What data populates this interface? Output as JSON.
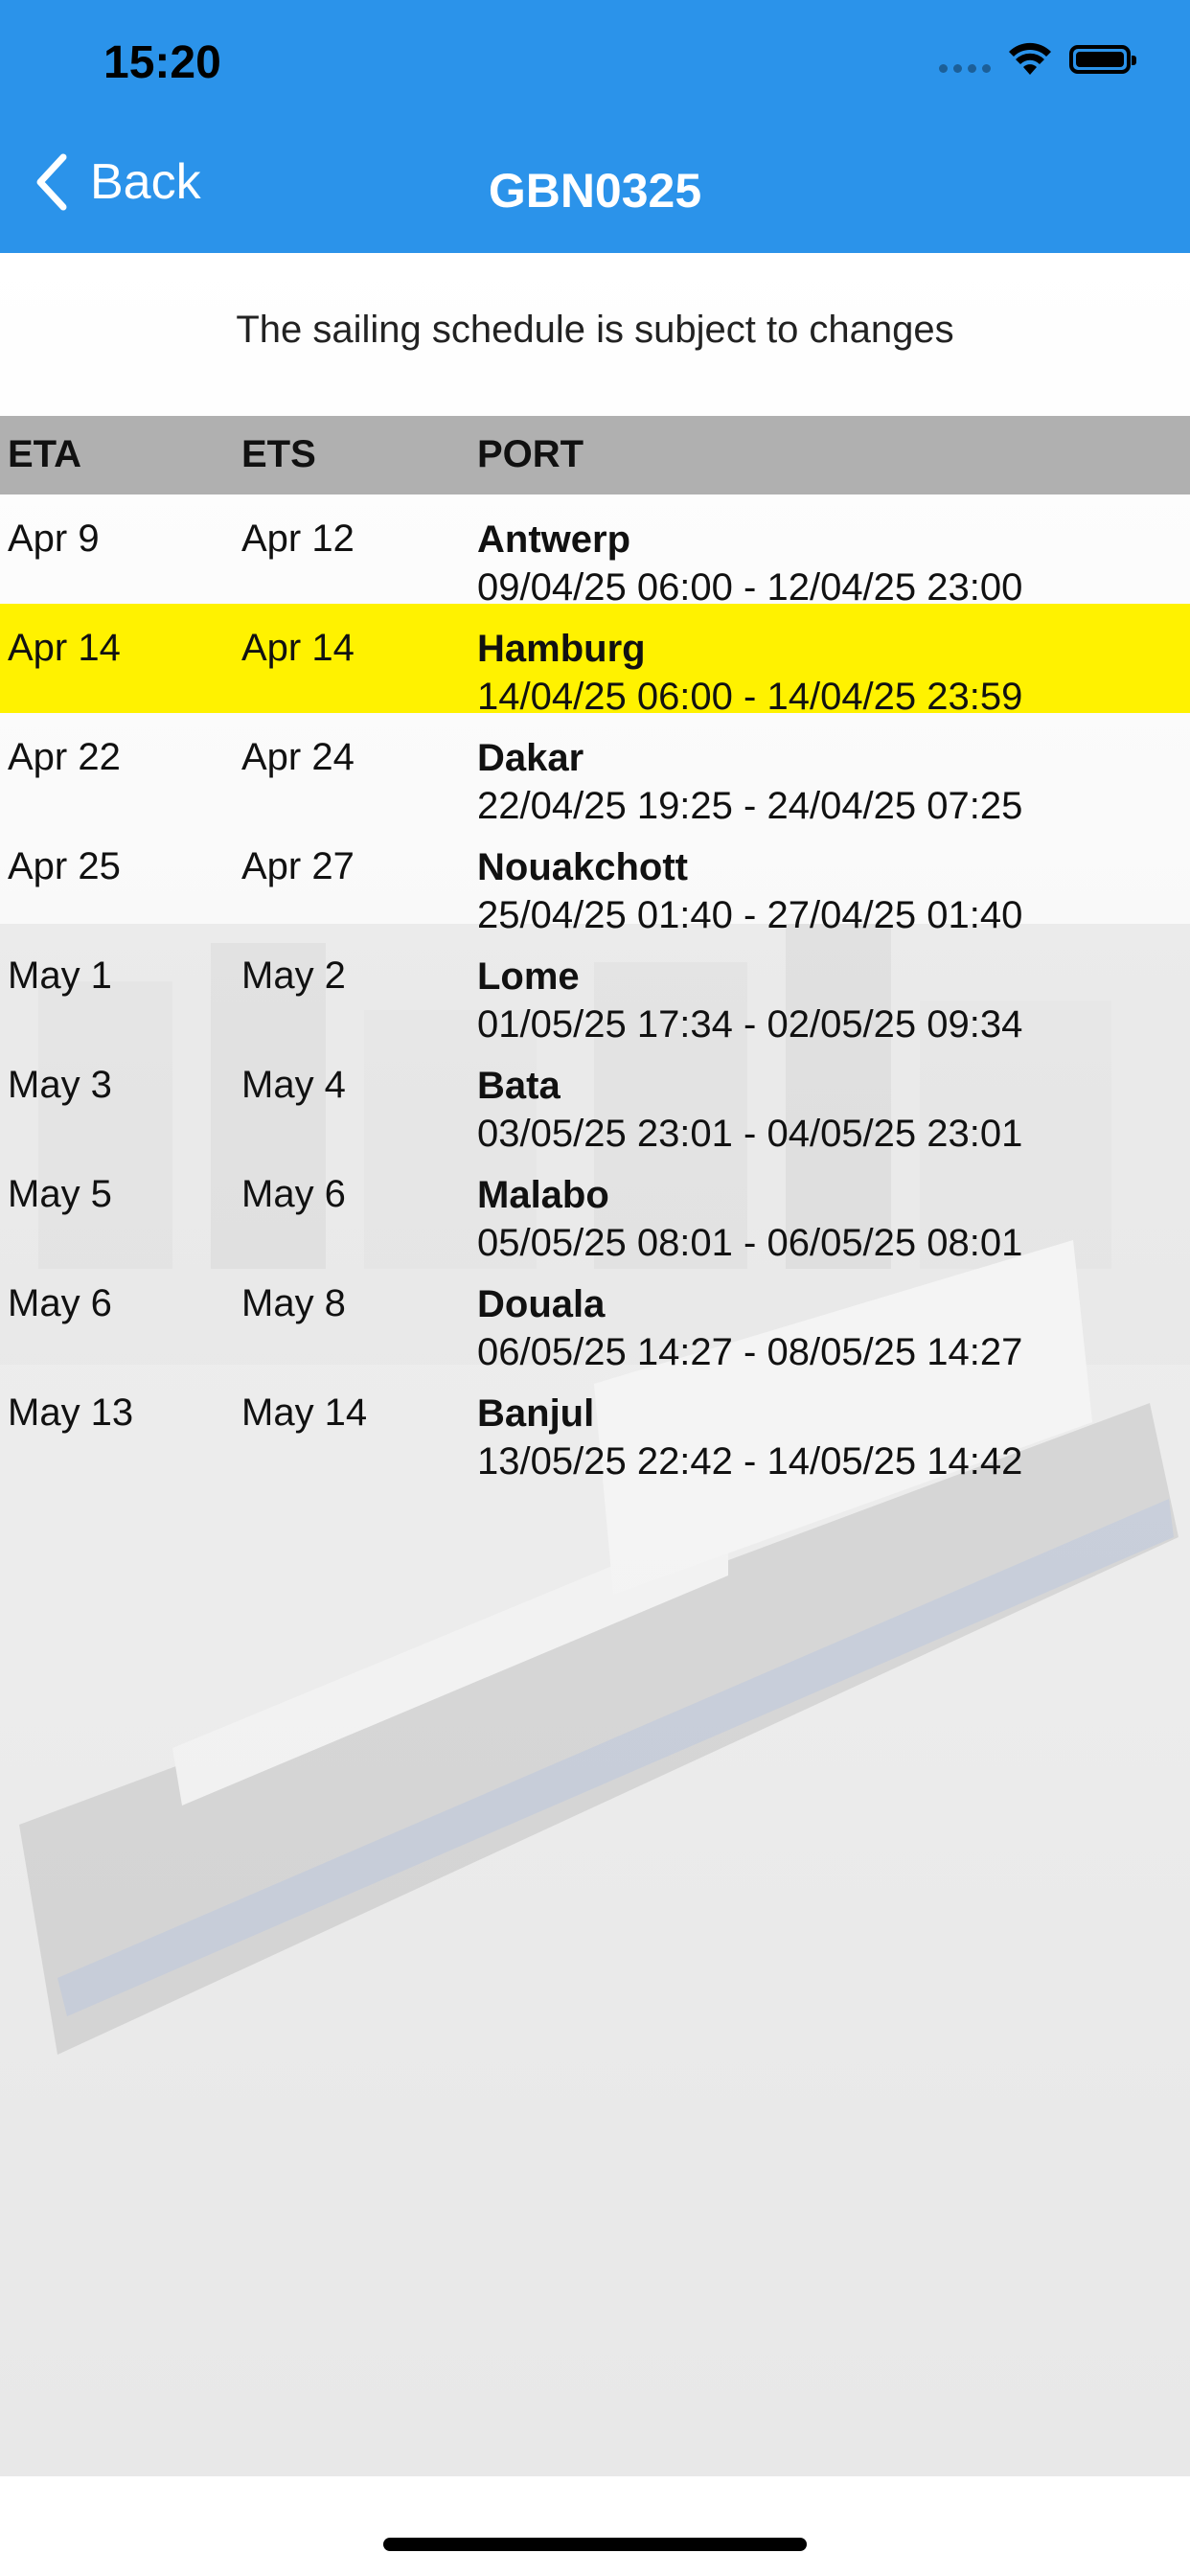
{
  "status_bar": {
    "time": "15:20",
    "icons": [
      "signal-icon",
      "wifi-icon",
      "battery-icon"
    ]
  },
  "nav": {
    "back_label": "Back",
    "title": "GBN0325"
  },
  "notice": "The sailing schedule is subject to changes",
  "table": {
    "headers": {
      "eta": "ETA",
      "ets": "ETS",
      "port": "PORT"
    },
    "rows": [
      {
        "eta": "Apr 9",
        "ets": "Apr 12",
        "port": "Antwerp",
        "range": "09/04/25 06:00 - 12/04/25 23:00",
        "highlight": false
      },
      {
        "eta": "Apr 14",
        "ets": "Apr 14",
        "port": "Hamburg",
        "range": "14/04/25 06:00 - 14/04/25 23:59",
        "highlight": true
      },
      {
        "eta": "Apr 22",
        "ets": "Apr 24",
        "port": "Dakar",
        "range": "22/04/25 19:25 - 24/04/25 07:25",
        "highlight": false
      },
      {
        "eta": "Apr 25",
        "ets": "Apr 27",
        "port": "Nouakchott",
        "range": "25/04/25 01:40 - 27/04/25 01:40",
        "highlight": false
      },
      {
        "eta": "May 1",
        "ets": "May 2",
        "port": "Lome",
        "range": "01/05/25 17:34 - 02/05/25 09:34",
        "highlight": false
      },
      {
        "eta": "May 3",
        "ets": "May 4",
        "port": "Bata",
        "range": "03/05/25 23:01 - 04/05/25 23:01",
        "highlight": false
      },
      {
        "eta": "May 5",
        "ets": "May 6",
        "port": "Malabo",
        "range": "05/05/25 08:01 - 06/05/25 08:01",
        "highlight": false
      },
      {
        "eta": "May 6",
        "ets": "May 8",
        "port": "Douala",
        "range": "06/05/25 14:27 - 08/05/25 14:27",
        "highlight": false
      },
      {
        "eta": "May 13",
        "ets": "May 14",
        "port": "Banjul",
        "range": "13/05/25 22:42 - 14/05/25 14:42",
        "highlight": false
      }
    ]
  },
  "colors": {
    "header_bg": "#2b93ea",
    "highlight_row": "#fff200",
    "table_header_bg": "#b0b0b0"
  }
}
